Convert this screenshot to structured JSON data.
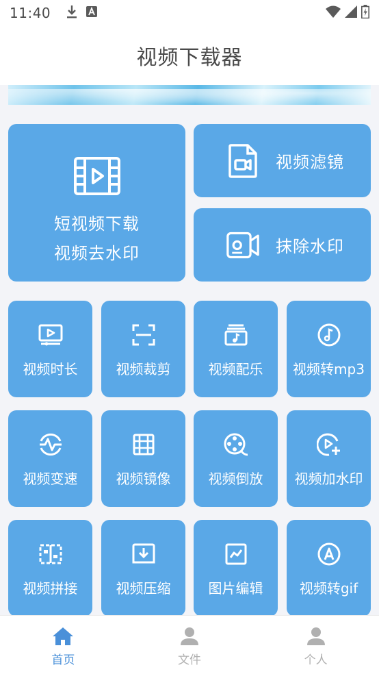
{
  "status_bar": {
    "time": "11:40",
    "icons": [
      "download-icon",
      "a-badge-icon",
      "wifi-icon",
      "signal-icon",
      "battery-icon"
    ]
  },
  "header": {
    "title": "视频下载器"
  },
  "colors": {
    "tile": "#5aa8e7",
    "nav_active": "#4a90d9",
    "nav_inactive": "#b0b0b0"
  },
  "main_feature": {
    "line1": "短视频下载",
    "line2": "视频去水印",
    "icon": "film-play-icon"
  },
  "side_features": [
    {
      "label": "视频滤镜",
      "icon": "video-file-icon"
    },
    {
      "label": "抹除水印",
      "icon": "camera-icon"
    }
  ],
  "tools": [
    {
      "label": "视频时长",
      "icon": "monitor-play-icon"
    },
    {
      "label": "视频裁剪",
      "icon": "crop-icon"
    },
    {
      "label": "视频配乐",
      "icon": "music-album-icon"
    },
    {
      "label": "视频转mp3",
      "icon": "music-note-icon"
    },
    {
      "label": "视频变速",
      "icon": "speed-wave-icon"
    },
    {
      "label": "视频镜像",
      "icon": "film-strip-icon"
    },
    {
      "label": "视频倒放",
      "icon": "reel-icon"
    },
    {
      "label": "视频加水印",
      "icon": "play-plus-icon"
    },
    {
      "label": "视频拼接",
      "icon": "splice-icon"
    },
    {
      "label": "视频压缩",
      "icon": "compress-download-icon"
    },
    {
      "label": "图片编辑",
      "icon": "image-chart-icon"
    },
    {
      "label": "视频转gif",
      "icon": "gif-a-icon"
    }
  ],
  "nav": [
    {
      "label": "首页",
      "icon": "home-icon",
      "active": true
    },
    {
      "label": "文件",
      "icon": "person-icon",
      "active": false
    },
    {
      "label": "个人",
      "icon": "person-icon",
      "active": false
    }
  ]
}
